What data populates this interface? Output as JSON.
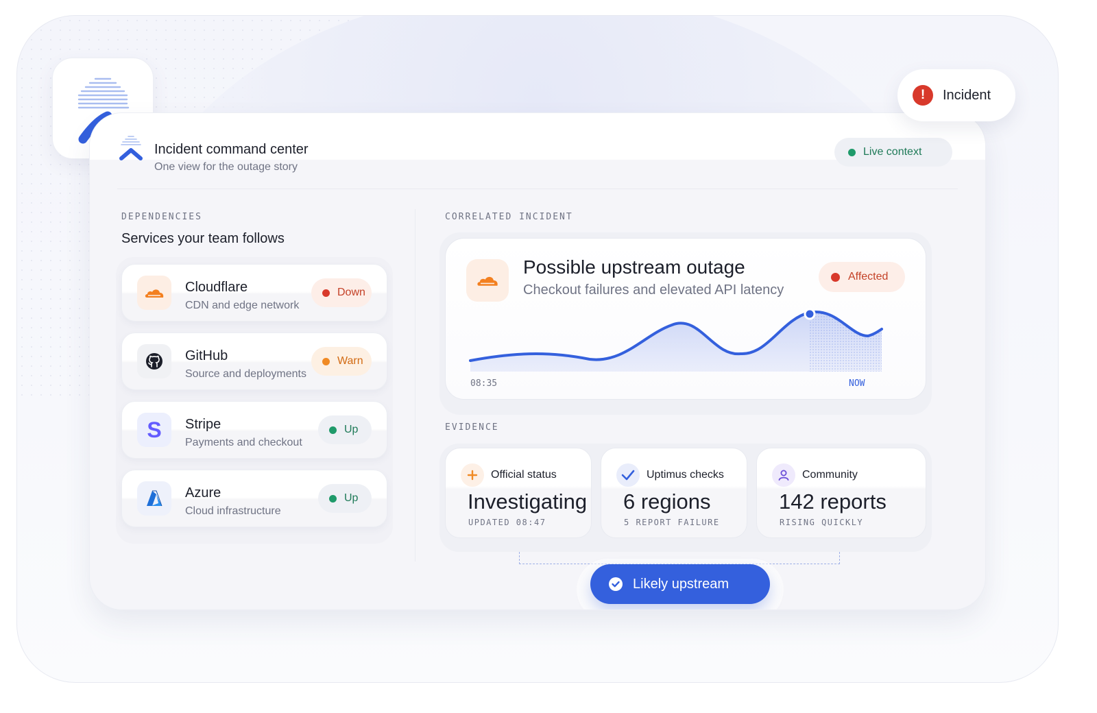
{
  "incident_badge": {
    "label": "Incident",
    "icon": "alert-circle-icon",
    "color": "#d8392b"
  },
  "header": {
    "title": "Incident command center",
    "subtitle": "One view for the outage story",
    "live": {
      "label": "Live context",
      "color": "#1f9a6a"
    }
  },
  "dependencies": {
    "section_label": "DEPENDENCIES",
    "title": "Services your team follows",
    "items": [
      {
        "name": "Cloudflare",
        "description": "CDN and edge network",
        "icon": "cloudflare-icon",
        "status": "Down",
        "status_color": "#d8392b",
        "status_text_color": "#c44127",
        "status_bg": "#fdeee8"
      },
      {
        "name": "GitHub",
        "description": "Source and deployments",
        "icon": "github-icon",
        "status": "Warn",
        "status_color": "#f08a24",
        "status_text_color": "#d26a12",
        "status_bg": "#fdf0e3"
      },
      {
        "name": "Stripe",
        "description": "Payments and checkout",
        "icon": "stripe-icon",
        "status": "Up",
        "status_color": "#1f9a6a",
        "status_text_color": "#1f7a58",
        "status_bg": "#eef0f5"
      },
      {
        "name": "Azure",
        "description": "Cloud infrastructure",
        "icon": "azure-icon",
        "status": "Up",
        "status_color": "#1f9a6a",
        "status_text_color": "#1f7a58",
        "status_bg": "#eef0f5"
      }
    ]
  },
  "correlated": {
    "section_label": "CORRELATED INCIDENT",
    "title": "Possible upstream outage",
    "subtitle": "Checkout failures and elevated API latency",
    "icon": "cloudflare-icon",
    "status": {
      "label": "Affected",
      "color": "#d8392b"
    },
    "sparkline": {
      "start_label": "08:35",
      "end_label": "NOW"
    }
  },
  "evidence": {
    "section_label": "EVIDENCE",
    "cards": [
      {
        "label": "Official status",
        "icon": "plus-icon",
        "value": "Investigating",
        "meta": "UPDATED 08:47"
      },
      {
        "label": "Uptimus checks",
        "icon": "check-icon",
        "value": "6 regions",
        "meta": "5 REPORT FAILURE"
      },
      {
        "label": "Community",
        "icon": "user-icon",
        "value": "142 reports",
        "meta": "RISING QUICKLY"
      }
    ]
  },
  "verdict": {
    "label": "Likely upstream",
    "icon": "check-circle-icon"
  },
  "colors": {
    "accent": "#3460dd",
    "down": "#d8392b",
    "warn": "#f08a24",
    "up": "#1f9a6a"
  }
}
